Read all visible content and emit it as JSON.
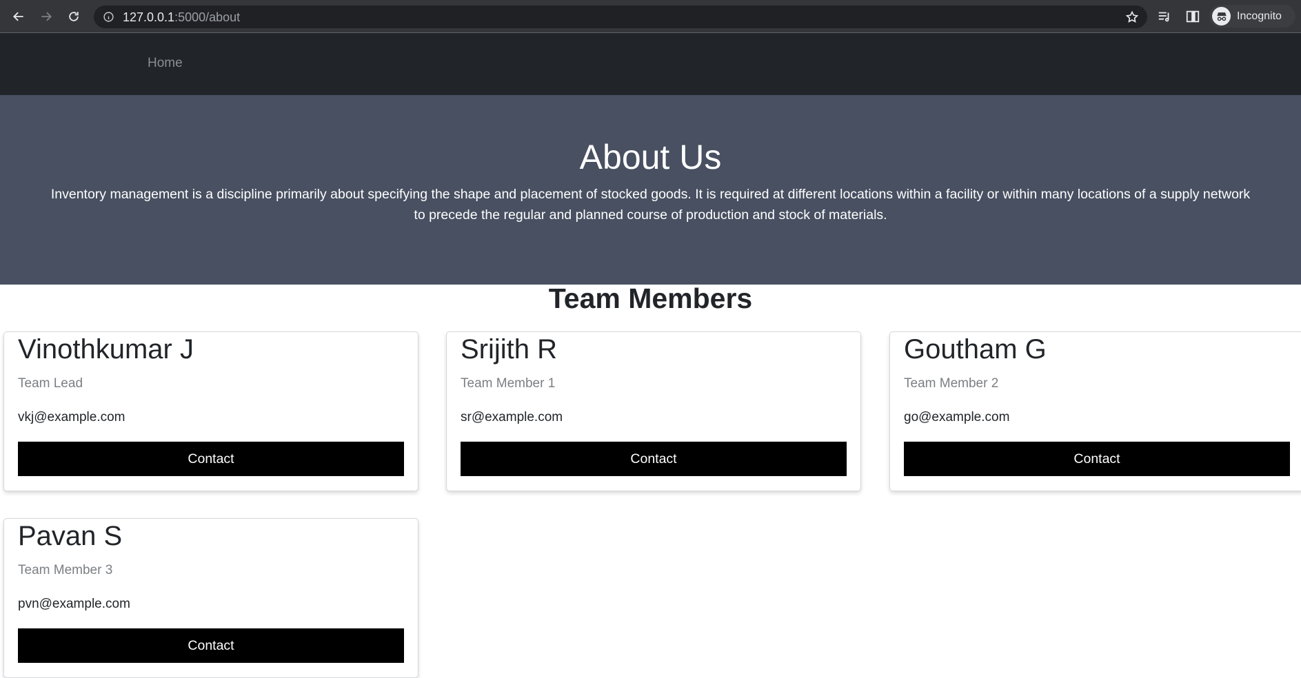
{
  "browser": {
    "url_host": "127.0.0.1",
    "url_path": ":5000/about",
    "profile_label": "Incognito"
  },
  "nav": {
    "home_label": "Home"
  },
  "hero": {
    "title": "About Us",
    "description": "Inventory management is a discipline primarily about specifying the shape and placement of stocked goods. It is required at different locations within a facility or within many locations of a supply network to precede the regular and planned course of production and stock of materials."
  },
  "team": {
    "heading": "Team Members",
    "members": [
      {
        "name": "Vinothkumar J",
        "role": "Team Lead",
        "email": "vkj@example.com",
        "button": "Contact"
      },
      {
        "name": "Srijith R",
        "role": "Team Member 1",
        "email": "sr@example.com",
        "button": "Contact"
      },
      {
        "name": "Goutham G",
        "role": "Team Member 2",
        "email": "go@example.com",
        "button": "Contact"
      },
      {
        "name": "Pavan S",
        "role": "Team Member 3",
        "email": "pvn@example.com",
        "button": "Contact"
      }
    ]
  },
  "colors": {
    "navbar": "#212529",
    "hero": "#485061",
    "button": "#000000"
  }
}
